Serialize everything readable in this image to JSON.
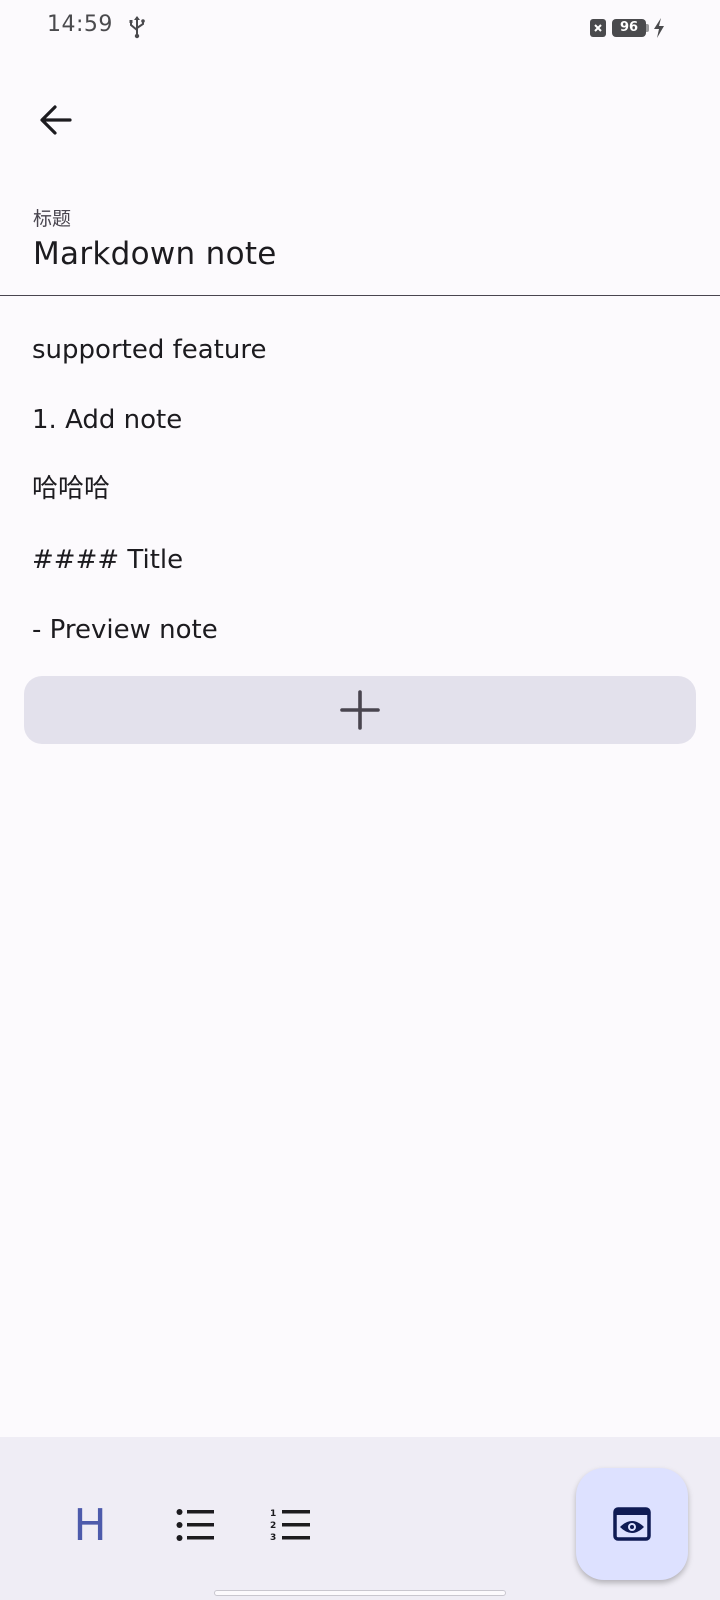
{
  "status_bar": {
    "time": "14:59",
    "battery_level": "96",
    "icons": [
      "usb-icon",
      "sim-off-icon",
      "battery-icon",
      "charging-icon"
    ]
  },
  "header": {
    "back_icon": "arrow-left-icon"
  },
  "title_field": {
    "label": "标题",
    "value": "Markdown note"
  },
  "note_lines": [
    "supported feature",
    "1. Add note",
    "哈哈哈",
    "#### Title",
    "- Preview note"
  ],
  "add_line": {
    "icon": "plus-icon"
  },
  "toolbar": {
    "heading_label": "H",
    "bullet_icon": "bulleted-list-icon",
    "numbered_icon": "numbered-list-icon",
    "preview_icon": "preview-eye-icon"
  },
  "colors": {
    "background": "#fcfafd",
    "toolbar_background": "#efedf5",
    "add_button_background": "#e3e1ec",
    "fab_background": "#dde1ff",
    "heading_accent": "#4d5bab",
    "fab_icon": "#0f1b54"
  }
}
